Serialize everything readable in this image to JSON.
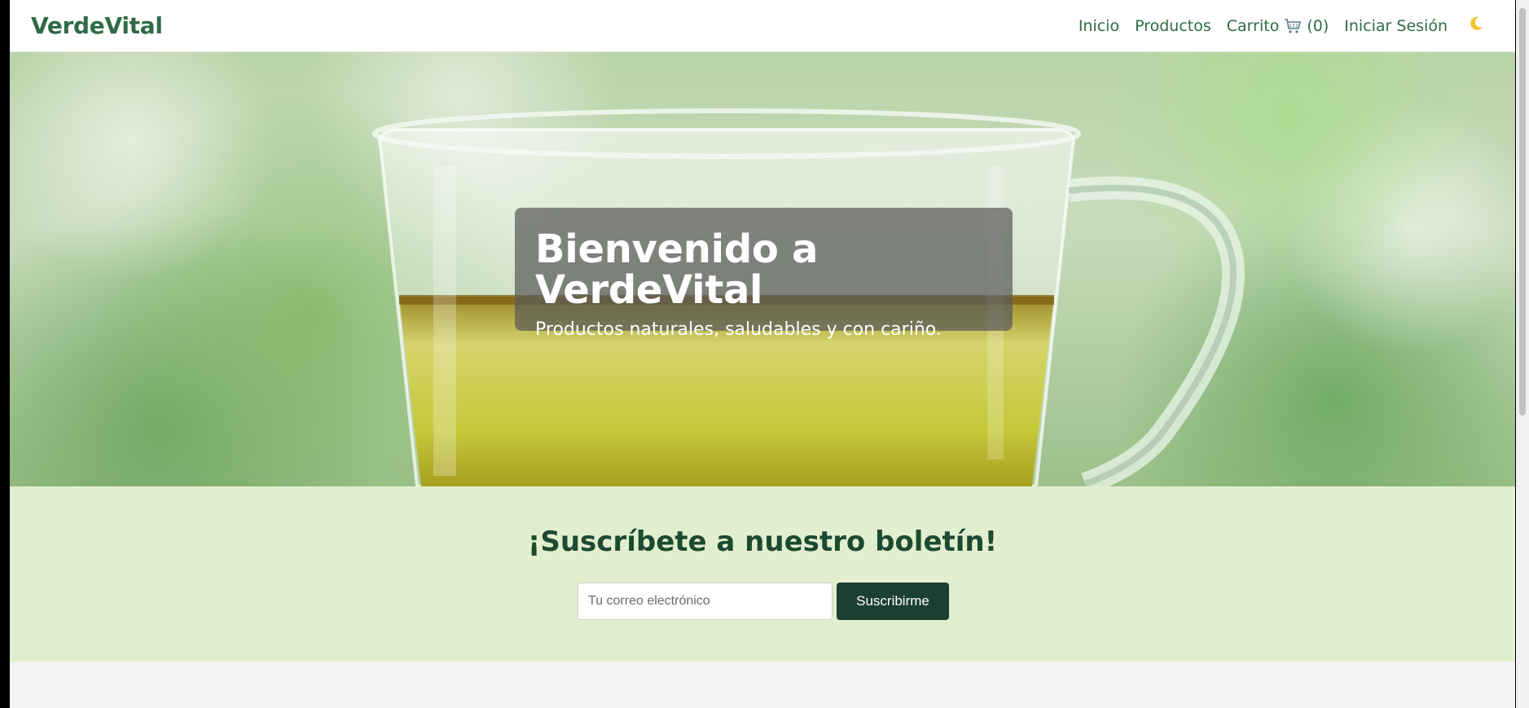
{
  "navbar": {
    "brand": "VerdeVital",
    "links": {
      "home": "Inicio",
      "products": "Productos",
      "cart": "Carrito",
      "cart_count": "(0)",
      "login": "Iniciar Sesión"
    },
    "icons": {
      "cart": "cart-icon",
      "theme": "moon-icon"
    }
  },
  "hero": {
    "title": "Bienvenido a VerdeVital",
    "subtitle": "Productos naturales, saludables y con cariño."
  },
  "newsletter": {
    "title": "¡Suscríbete a nuestro boletín!",
    "email_placeholder": "Tu correo electrónico",
    "email_value": "",
    "button_label": "Suscribirme"
  },
  "colors": {
    "brand_green": "#2e6b45",
    "dark_green": "#1b3f30",
    "newsletter_bg": "#e2efce"
  }
}
